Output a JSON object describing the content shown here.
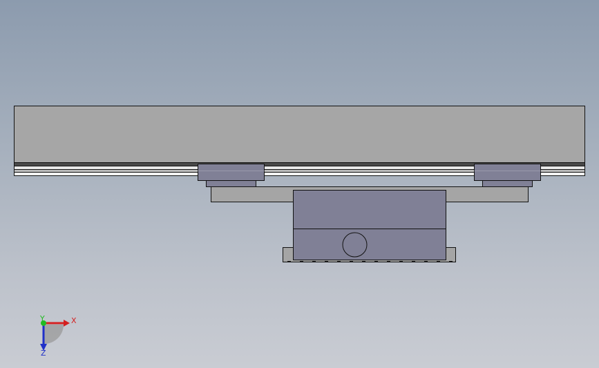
{
  "viewport": {
    "background_top": "#8c9bae",
    "background_bottom": "#c9ccd3"
  },
  "model": {
    "colors": {
      "rail": "#a6a6a6",
      "carriage": "#808096",
      "plate": "#a5a5a5",
      "outline": "#111111",
      "stripe_dark": "#4a4a4a",
      "stripe_light": "#e8e8e8"
    }
  },
  "triad": {
    "x_label": "X",
    "y_label": "Y",
    "z_label": "Z",
    "x_color": "#d42020",
    "y_color": "#22bb22",
    "z_color": "#2030c8"
  }
}
